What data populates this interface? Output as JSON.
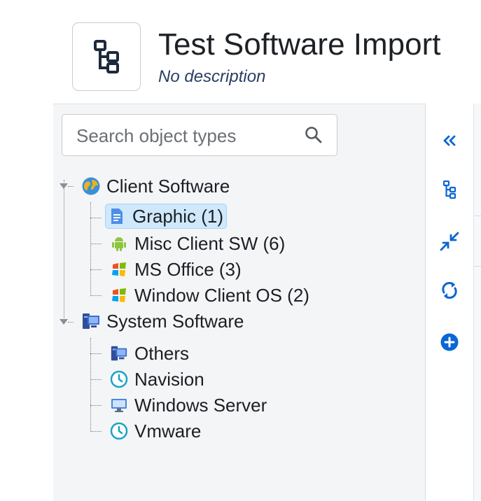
{
  "header": {
    "title": "Test Software Import",
    "description": "No description"
  },
  "search": {
    "placeholder": "Search object types"
  },
  "tree": {
    "client": {
      "label": "Client Software",
      "children": [
        {
          "label": "Graphic (1)",
          "icon": "document-icon",
          "selected": true
        },
        {
          "label": "Misc Client SW (6)",
          "icon": "android-icon"
        },
        {
          "label": "MS Office (3)",
          "icon": "windows-logo-icon"
        },
        {
          "label": "Window Client OS (2)",
          "icon": "windows-logo-icon"
        }
      ]
    },
    "system": {
      "label": "System Software",
      "children": [
        {
          "label": "Others",
          "icon": "computer-icon"
        },
        {
          "label": "Navision",
          "icon": "clock-icon"
        },
        {
          "label": "Windows Server",
          "icon": "monitor-icon"
        },
        {
          "label": "Vmware",
          "icon": "clock-icon"
        }
      ]
    }
  },
  "toolbar": [
    "collapse-panel-icon",
    "schema-tree-icon",
    "collapse-arrows-icon",
    "refresh-icon",
    "add-icon"
  ],
  "colors": {
    "accent": "#0b66d6",
    "selected_bg": "#cfe8fb",
    "panel_bg": "#f4f5f7"
  }
}
